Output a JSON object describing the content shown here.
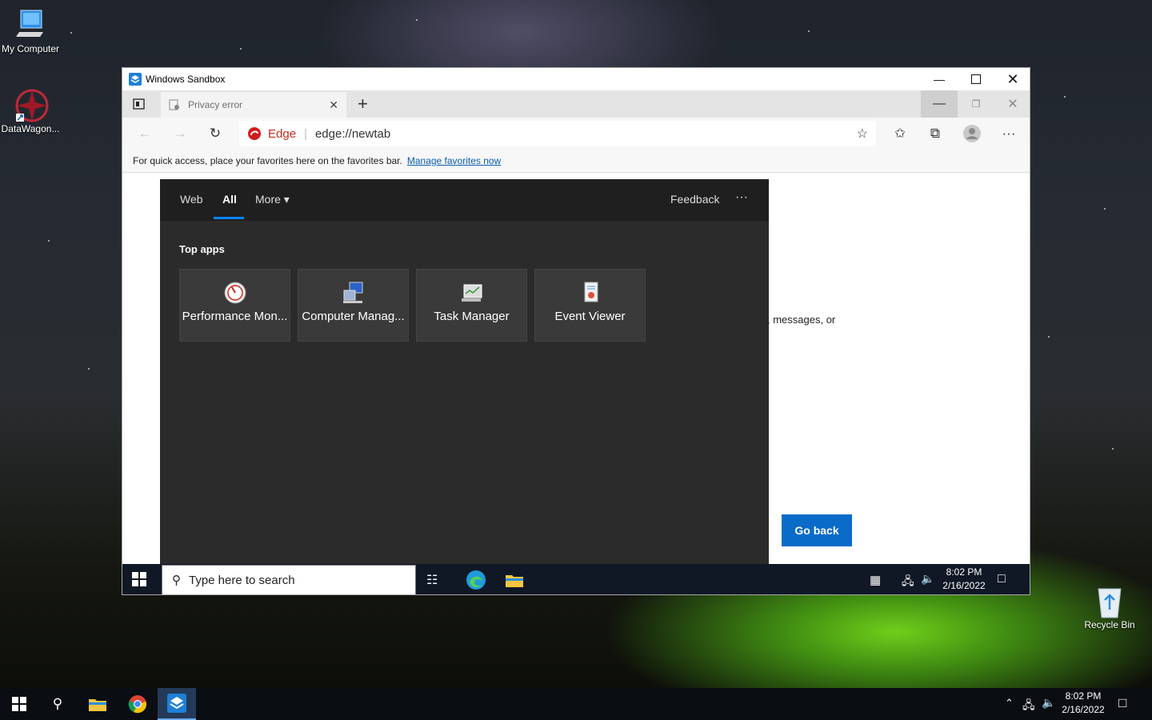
{
  "desktop": {
    "icons": [
      {
        "label": "My Computer"
      },
      {
        "label": "DataWagon..."
      },
      {
        "label": "Recycle Bin"
      }
    ]
  },
  "sandbox": {
    "title": "Windows Sandbox"
  },
  "edge": {
    "tab_title": "Privacy error",
    "url_brand": "Edge",
    "url": "edge://newtab",
    "favbar_text": "For quick access, place your favorites here on the favorites bar.",
    "favbar_link": "Manage favorites now",
    "page_snippet": ", messages, or",
    "go_back_label": "Go back"
  },
  "search_panel": {
    "tabs": [
      "Web",
      "All",
      "More"
    ],
    "active_tab": "All",
    "feedback": "Feedback",
    "more_dots": "···",
    "section_title": "Top apps",
    "apps": [
      {
        "label": "Performance Mon...",
        "icon": "performance-monitor-icon"
      },
      {
        "label": "Computer Manag...",
        "icon": "computer-management-icon"
      },
      {
        "label": "Task Manager",
        "icon": "task-manager-icon"
      },
      {
        "label": "Event Viewer",
        "icon": "event-viewer-icon"
      }
    ],
    "accent": "#0a84ff"
  },
  "inner_taskbar": {
    "search_placeholder": "Type here to search",
    "time": "8:02 PM",
    "date": "2/16/2022"
  },
  "taskbar": {
    "time": "8:02 PM",
    "date": "2/16/2022"
  }
}
